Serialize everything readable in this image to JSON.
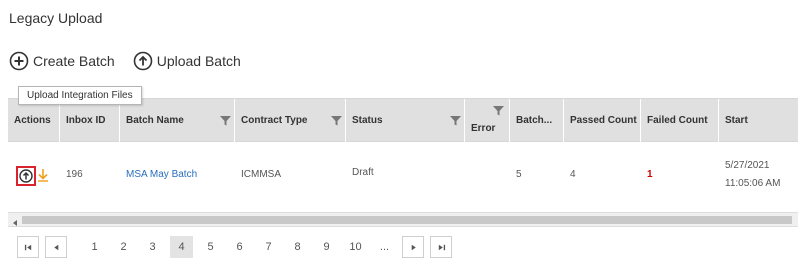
{
  "page": {
    "title": "Legacy Upload"
  },
  "toolbar": {
    "create_label": "Create Batch",
    "upload_label": "Upload Batch",
    "create_icon": "plus-circle-icon",
    "upload_icon": "upload-circle-icon"
  },
  "grid": {
    "columns": [
      {
        "label": "Actions"
      },
      {
        "label": "Inbox ID"
      },
      {
        "label": "Batch Name"
      },
      {
        "label": "Contract Type"
      },
      {
        "label": "Status"
      },
      {
        "label": "Error"
      },
      {
        "label": "Batch..."
      },
      {
        "label": "Passed Count"
      },
      {
        "label": "Failed Count"
      },
      {
        "label": "Start"
      }
    ],
    "rows": [
      {
        "inbox_id": "196",
        "batch_name": "MSA May Batch",
        "contract_type": "ICMMSA",
        "status": "Draft",
        "error": "",
        "batch": "5",
        "passed_count": "4",
        "failed_count": "1",
        "start_date": "5/27/2021",
        "start_time": "11:05:06 AM"
      }
    ]
  },
  "tooltip": {
    "text": "Upload Integration Files"
  },
  "pager": {
    "pages": [
      "1",
      "2",
      "3",
      "4",
      "5",
      "6",
      "7",
      "8",
      "9",
      "10",
      "..."
    ],
    "current": "4"
  },
  "colors": {
    "header_bg": "#e0e0e0",
    "link": "#2a6ebb",
    "failed": "#cc0000",
    "highlight": "#d9232e",
    "download_icon": "#f0a020"
  }
}
